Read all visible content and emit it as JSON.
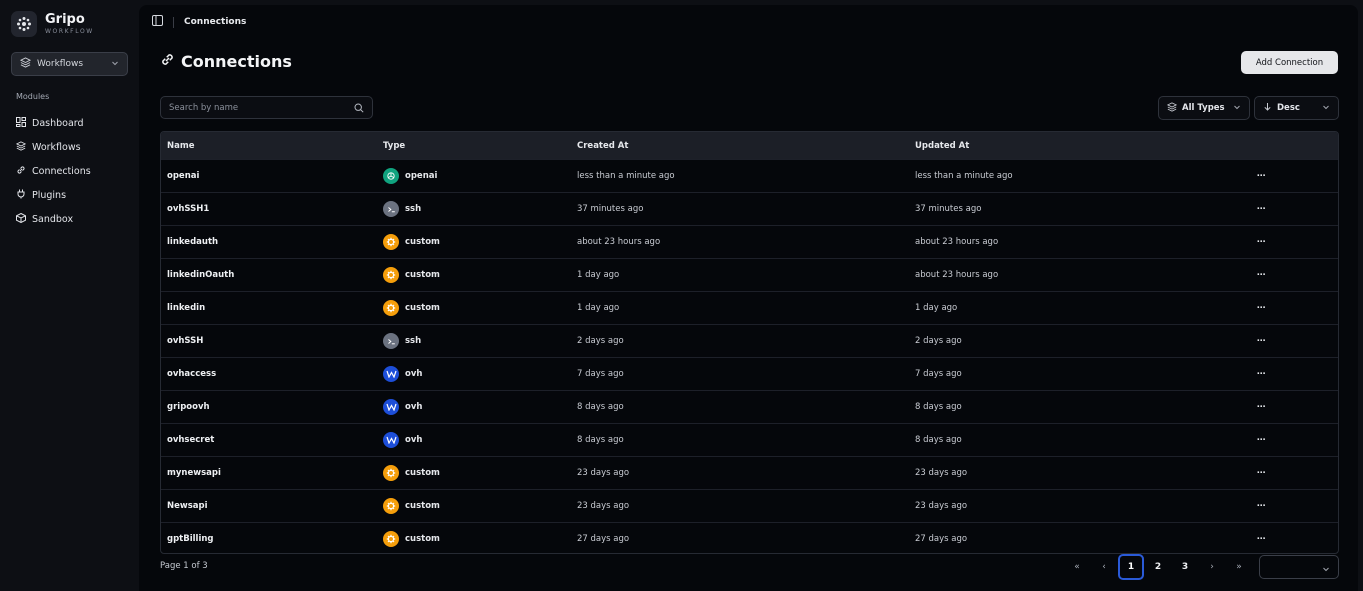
{
  "brand": {
    "name": "Gripo",
    "subtitle": "WORKFLOW"
  },
  "workspace_select": {
    "value": "Workflows"
  },
  "sidebar": {
    "section_label": "Modules",
    "items": [
      {
        "label": "Dashboard",
        "icon": "dashboard-icon"
      },
      {
        "label": "Workflows",
        "icon": "layers-icon"
      },
      {
        "label": "Connections",
        "icon": "link-icon"
      },
      {
        "label": "Plugins",
        "icon": "plug-icon"
      },
      {
        "label": "Sandbox",
        "icon": "box-icon"
      }
    ]
  },
  "topbar": {
    "breadcrumb": "Connections"
  },
  "page": {
    "title": "Connections",
    "add_button": "Add Connection"
  },
  "search": {
    "placeholder": "Search by name",
    "value": ""
  },
  "filters": {
    "type": "All Types",
    "sort": "Desc"
  },
  "table": {
    "columns": [
      "Name",
      "Type",
      "Created At",
      "Updated At"
    ],
    "rows": [
      {
        "name": "openai",
        "type": "openai",
        "created": "less than a minute ago",
        "updated": "less than a minute ago"
      },
      {
        "name": "ovhSSH1",
        "type": "ssh",
        "created": "37 minutes ago",
        "updated": "37 minutes ago"
      },
      {
        "name": "linkedauth",
        "type": "custom",
        "created": "about 23 hours ago",
        "updated": "about 23 hours ago"
      },
      {
        "name": "linkedinOauth",
        "type": "custom",
        "created": "1 day ago",
        "updated": "about 23 hours ago"
      },
      {
        "name": "linkedin",
        "type": "custom",
        "created": "1 day ago",
        "updated": "1 day ago"
      },
      {
        "name": "ovhSSH",
        "type": "ssh",
        "created": "2 days ago",
        "updated": "2 days ago"
      },
      {
        "name": "ovhaccess",
        "type": "ovh",
        "created": "7 days ago",
        "updated": "7 days ago"
      },
      {
        "name": "gripoovh",
        "type": "ovh",
        "created": "8 days ago",
        "updated": "8 days ago"
      },
      {
        "name": "ovhsecret",
        "type": "ovh",
        "created": "8 days ago",
        "updated": "8 days ago"
      },
      {
        "name": "mynewsapi",
        "type": "custom",
        "created": "23 days ago",
        "updated": "23 days ago"
      },
      {
        "name": "Newsapi",
        "type": "custom",
        "created": "23 days ago",
        "updated": "23 days ago"
      },
      {
        "name": "gptBilling",
        "type": "custom",
        "created": "27 days ago",
        "updated": "27 days ago"
      }
    ],
    "row_action": "⋯"
  },
  "pagination": {
    "label": "Page 1 of 3",
    "pages": [
      "1",
      "2",
      "3"
    ],
    "current": "1"
  },
  "colors": {
    "accent": "#2a5ad8",
    "openai": "#10a37f",
    "ssh": "#6b7280",
    "custom": "#f59e0b",
    "ovh": "#1d4ed8"
  }
}
